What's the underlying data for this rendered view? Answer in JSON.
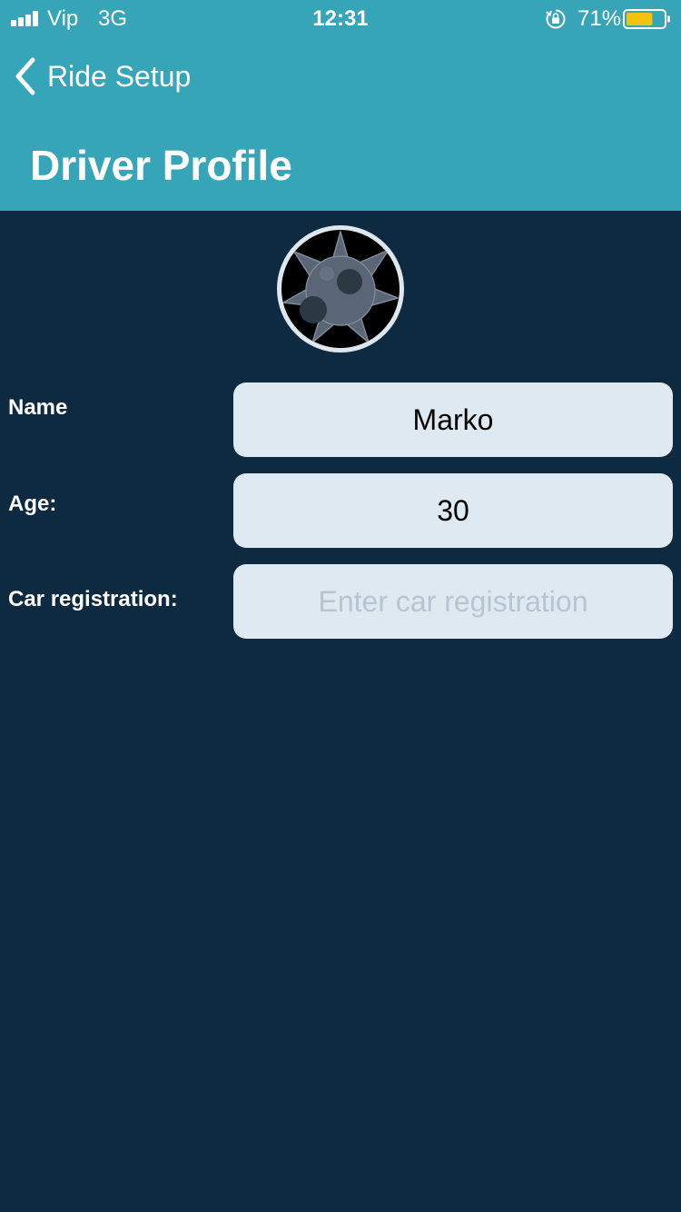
{
  "status_bar": {
    "carrier": "Vip",
    "network": "3G",
    "time": "12:31",
    "battery_percent": "71%",
    "battery_level": 0.71,
    "battery_color": "#f5c30f",
    "icons": [
      "signal-bars-icon",
      "rotation-lock-icon",
      "battery-icon"
    ]
  },
  "nav": {
    "back_label": "Ride Setup",
    "back_icon": "chevron-left-icon",
    "title": "Driver Profile"
  },
  "profile": {
    "avatar_icon": "spiked-ball-avatar"
  },
  "form": {
    "name": {
      "label": "Name",
      "value": "Marko"
    },
    "age": {
      "label": "Age:",
      "value": "30"
    },
    "car_registration": {
      "label": "Car registration:",
      "value": "",
      "placeholder": "Enter car registration"
    }
  },
  "colors": {
    "header": "#36a5b8",
    "background": "#0e2a40",
    "input_background": "#dfe9f2"
  }
}
